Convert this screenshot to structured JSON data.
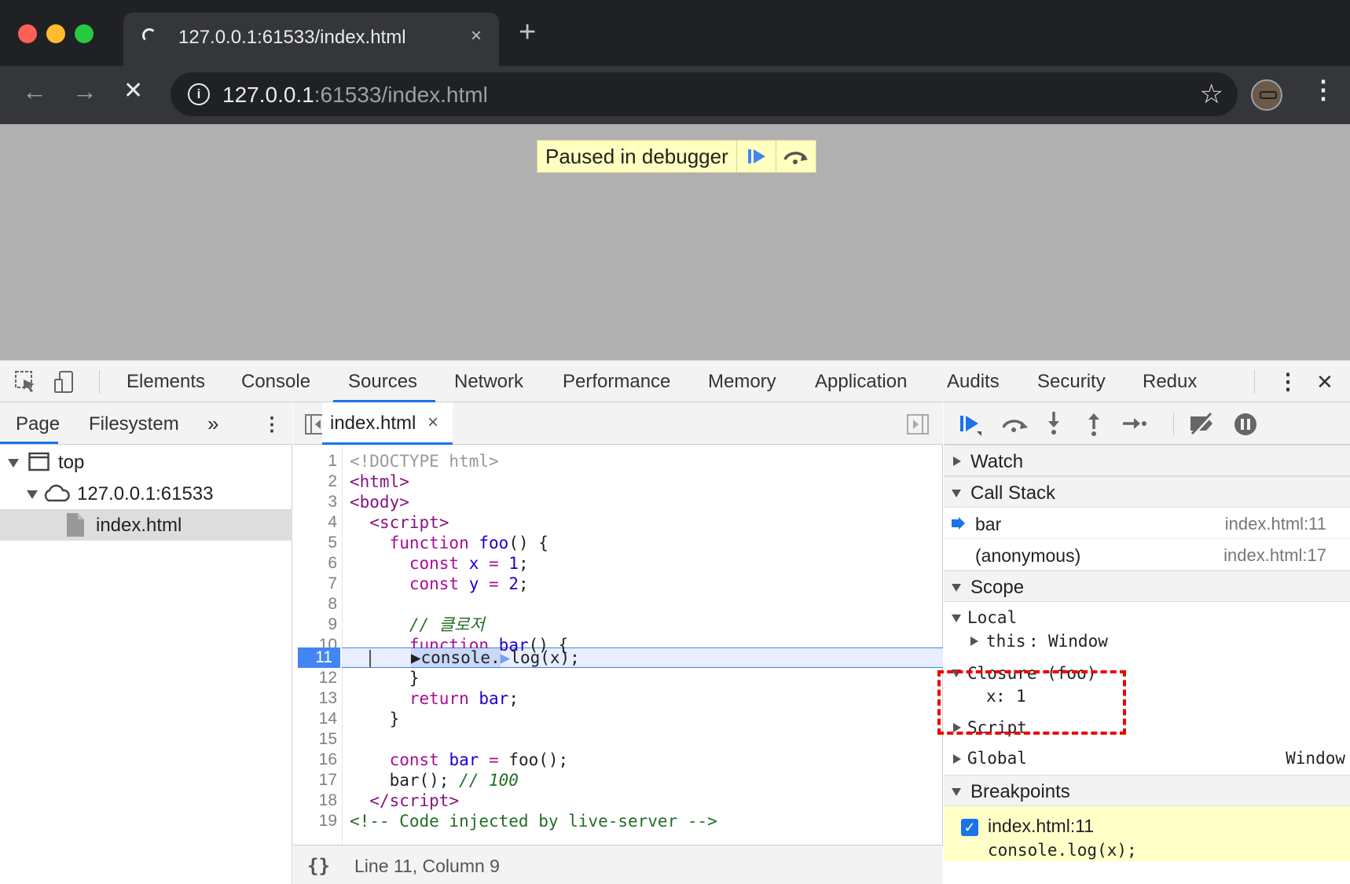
{
  "browser": {
    "tab_title": "127.0.0.1:61533/index.html",
    "tab_close": "×",
    "new_tab": "+",
    "url_host": "127.0.0.1",
    "url_rest": ":61533/index.html",
    "info_icon_glyph": "i",
    "back_glyph": "←",
    "forward_glyph": "→",
    "stop_glyph": "✕",
    "star_glyph": "☆",
    "menu_glyph": "⋮"
  },
  "page": {
    "paused_label": "Paused in debugger"
  },
  "devtools": {
    "tabs": [
      "Elements",
      "Console",
      "Sources",
      "Network",
      "Performance",
      "Memory",
      "Application",
      "Audits",
      "Security",
      "Redux"
    ],
    "active_tab": "Sources",
    "kebab": "⋮",
    "close": "✕",
    "navigator": {
      "tabs": [
        "Page",
        "Filesystem"
      ],
      "more": "»",
      "menu": "⋮",
      "tree": [
        "top",
        "127.0.0.1:61533",
        "index.html"
      ]
    },
    "editor": {
      "file_tab": "index.html",
      "file_close": "×",
      "current_line": 11,
      "status_braces": "{}",
      "status_position": "Line 11, Column 9"
    },
    "sidebar": {
      "watch": "Watch",
      "call_stack": "Call Stack",
      "frames": [
        {
          "name": "bar",
          "loc": "index.html:11"
        },
        {
          "name": "(anonymous)",
          "loc": "index.html:17"
        }
      ],
      "scope": "Scope",
      "local": "Local",
      "this_key": "this",
      "this_val": "Window",
      "closure": "Closure (foo)",
      "closure_key": "x",
      "closure_val": "1",
      "script": "Script",
      "global": "Global",
      "global_val": "Window",
      "breakpoints": "Breakpoints",
      "bp_file": "index.html:11",
      "bp_code": "console.log(x);"
    }
  },
  "colors": {
    "accent": "#1a73e8",
    "highlight_box": "#e00000",
    "paused_bg": "#ffffc0"
  }
}
